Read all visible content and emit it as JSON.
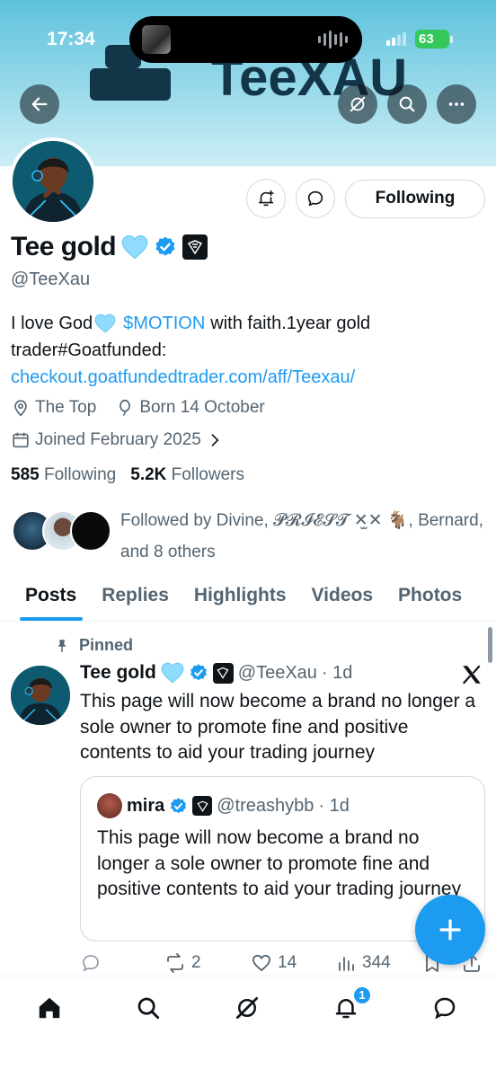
{
  "status_bar": {
    "time": "17:34",
    "battery": "63"
  },
  "banner": {
    "logo_text": "TeeXAU"
  },
  "profile": {
    "display_name": "Tee gold",
    "handle": "@TeeXau",
    "bio_line1_text": "I love God",
    "bio_cashtag": "$MOTION",
    "bio_line1_rest": "with faith.1year gold",
    "bio_line2": "trader#Goatfunded:",
    "bio_link": "checkout.goatfundedtrader.com/aff/Teexau/",
    "location": "The Top",
    "birthday": "Born 14 October",
    "joined": "Joined February 2025",
    "following_count": "585",
    "following_label": "Following",
    "followers_count": "5.2K",
    "followers_label": "Followers",
    "followed_by": "Followed by Divine, 𝓟𝓡𝓘𝓔𝓢𝓣 ✕̫✕ 🐐, Bernard, and 8 others",
    "follow_button": "Following"
  },
  "tabs": [
    {
      "label": "Posts",
      "active": true
    },
    {
      "label": "Replies",
      "active": false
    },
    {
      "label": "Highlights",
      "active": false
    },
    {
      "label": "Videos",
      "active": false
    },
    {
      "label": "Photos",
      "active": false
    }
  ],
  "post": {
    "pinned_label": "Pinned",
    "author": "Tee gold",
    "handle": "@TeeXau",
    "time": "· 1d",
    "text": "This page will now become a brand no longer a sole owner to promote fine and positive contents to aid your trading journey",
    "quote": {
      "author": "mira",
      "handle": "@treashybb",
      "time": "· 1d",
      "text": "This page will now become a brand no longer a sole owner to promote fine and positive contents to aid your trading journey"
    },
    "reposts": "2",
    "likes": "14",
    "views": "344"
  },
  "nav": {
    "notification_badge": "1"
  },
  "colors": {
    "accent": "#1d9bf0",
    "text": "#0f1419",
    "secondary": "#536471"
  }
}
